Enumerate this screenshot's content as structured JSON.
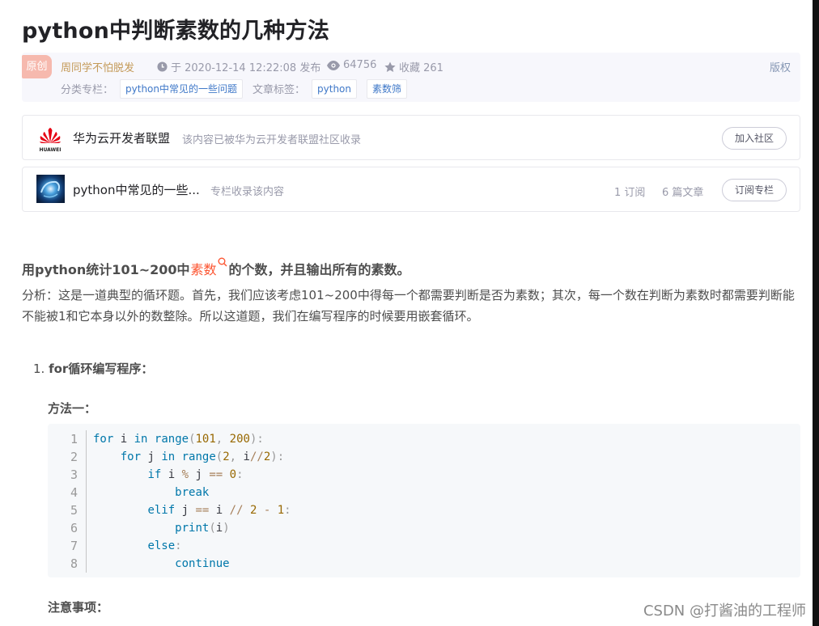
{
  "article": {
    "title": "python中判断素数的几种方法"
  },
  "meta": {
    "original_badge": "原创",
    "author": "周同学不怕脱发",
    "published": "于 2020-12-14 12:22:08 发布",
    "views": "64756",
    "favorites": "收藏 261",
    "copyright": "版权",
    "category_label": "分类专栏：",
    "category": "python中常见的一些问题",
    "tags_label": "文章标签：",
    "tags": [
      "python",
      "素数筛"
    ]
  },
  "community_card": {
    "logo_text": "HUAWEI",
    "title": "华为云开发者联盟",
    "desc": "该内容已被华为云开发者联盟社区收录",
    "button": "加入社区",
    "accent_color": "#e60012"
  },
  "column_card": {
    "title": "python中常见的一些...",
    "desc": "专栏收录该内容",
    "subscribers": "1 订阅",
    "articles": "6 篇文章",
    "button": "订阅专栏"
  },
  "content": {
    "heading_before": "用python统计101~200中",
    "heading_keyword": "素数",
    "heading_after": "的个数，并且输出所有的素数。",
    "keyword_color": "#fc5531",
    "paragraph": "分析：这是一道典型的循环题。首先，我们应该考虑101~200中得每一个都需要判断是否为素数；其次，每一个数在判断为素数时都需要判断能不能被1和它本身以外的数整除。所以这道题，我们在编写程序的时候要用嵌套循环。",
    "list_number": "1.",
    "list_item": "for循环编写程序：",
    "method": "方法一：",
    "note": "注意事项："
  },
  "code": {
    "line_numbers": [
      "1",
      "2",
      "3",
      "4",
      "5",
      "6",
      "7",
      "8"
    ]
  },
  "watermark": "CSDN @打酱油的工程师"
}
